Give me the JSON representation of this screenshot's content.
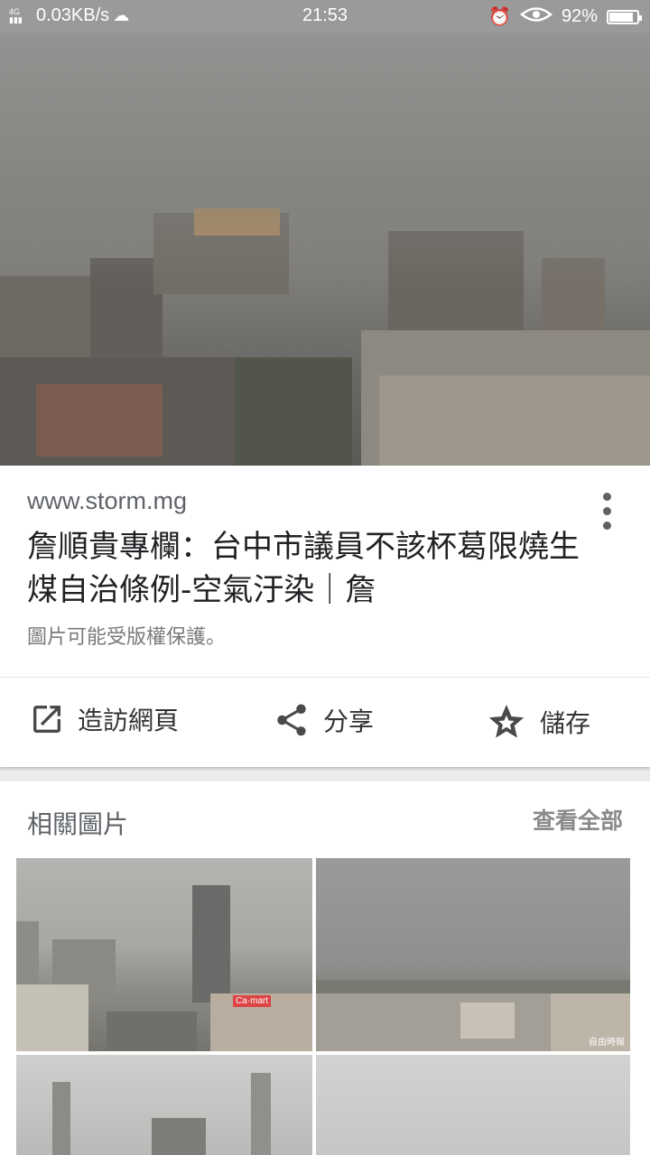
{
  "status_bar": {
    "network": "4G",
    "speed": "0.03KB/s",
    "time": "21:53",
    "battery": "92%",
    "battery_level": 0.92
  },
  "card": {
    "source": "www.storm.mg",
    "title": "詹順貴專欄：台中市議員不該杯葛限燒生煤自治條例-空氣汙染｜詹",
    "copyright": "圖片可能受版權保護。",
    "actions": [
      {
        "label": "造訪網頁",
        "icon": "open-in-new-icon"
      },
      {
        "label": "分享",
        "icon": "share-icon"
      },
      {
        "label": "儲存",
        "icon": "star-icon"
      }
    ]
  },
  "related": {
    "title": "相關圖片",
    "see_all": "查看全部",
    "thumb1_sign": "Ca·mart",
    "thumb2_watermark": "自由時報"
  }
}
